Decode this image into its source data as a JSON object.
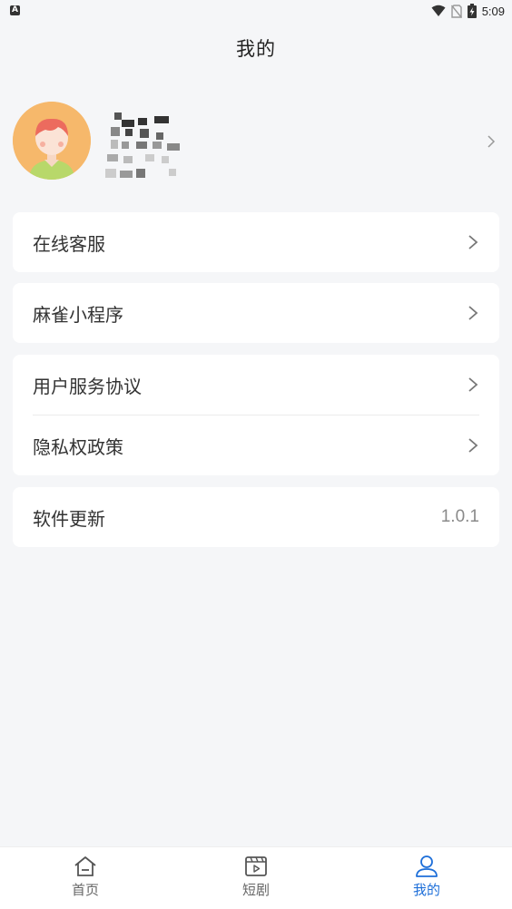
{
  "status_bar": {
    "left_icon": "A",
    "icons": [
      "wifi-icon",
      "no-sim-icon",
      "battery-charging-icon"
    ],
    "time": "5:09"
  },
  "header": {
    "title": "我的"
  },
  "profile": {
    "avatar_icon": "avatar-girl-icon",
    "username_obscured": true,
    "chevron_icon": "chevron-right-icon"
  },
  "menu": {
    "online_service": "在线客服",
    "mini_program": "麻雀小程序",
    "user_agreement": "用户服务协议",
    "privacy_policy": "隐私权政策",
    "software_update": "软件更新",
    "version": "1.0.1"
  },
  "bottom_nav": {
    "items": [
      {
        "label": "首页",
        "icon": "home-icon",
        "active": false
      },
      {
        "label": "短剧",
        "icon": "clapperboard-icon",
        "active": false
      },
      {
        "label": "我的",
        "icon": "user-icon",
        "active": true
      }
    ]
  },
  "colors": {
    "background": "#f5f6f8",
    "card": "#ffffff",
    "accent": "#1e6fd9",
    "avatar_bg": "#f6b86b"
  }
}
